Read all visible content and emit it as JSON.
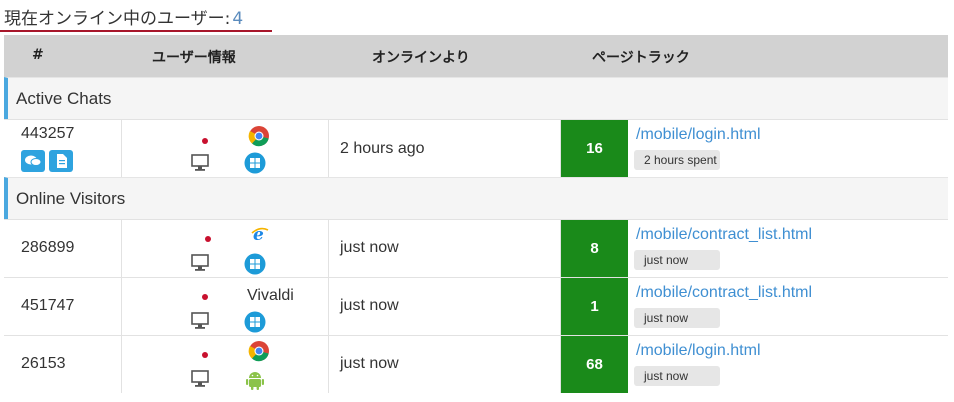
{
  "heading": {
    "label": "現在オンライン中のユーザー:",
    "count": "4"
  },
  "columns": {
    "hash": "#",
    "user_info": "ユーザー情報",
    "online_since": "オンラインより",
    "page_track": "ページトラック"
  },
  "sections": {
    "active_chats": "Active Chats",
    "online_visitors": "Online Visitors"
  },
  "rows": [
    {
      "id": "443257",
      "browser": "chrome-icon",
      "os": "windows-icon",
      "device": "desktop-icon",
      "since": "2 hours ago",
      "track_count": "16",
      "url": "/mobile/login.html",
      "badge": "2 hours spent"
    },
    {
      "id": "286899",
      "browser": "ie-icon",
      "os": "windows-icon",
      "device": "desktop-icon",
      "since": "just now",
      "track_count": "8",
      "url": "/mobile/contract_list.html",
      "badge": "just now"
    },
    {
      "id": "451747",
      "browser_label": "Vivaldi",
      "os": "windows-icon",
      "device": "desktop-icon",
      "since": "just now",
      "track_count": "1",
      "url": "/mobile/contract_list.html",
      "badge": "just now"
    },
    {
      "id": "26153",
      "browser": "chrome-icon",
      "os": "android-icon",
      "device": "desktop-icon",
      "since": "just now",
      "track_count": "68",
      "url": "/mobile/login.html",
      "badge": "just now"
    }
  ],
  "colors": {
    "accent_underline": "#a8172b",
    "section_border": "#4aa8df",
    "track_green": "#1a8a1a",
    "link": "#3f8fd2",
    "status_dot": "#c8102e"
  }
}
